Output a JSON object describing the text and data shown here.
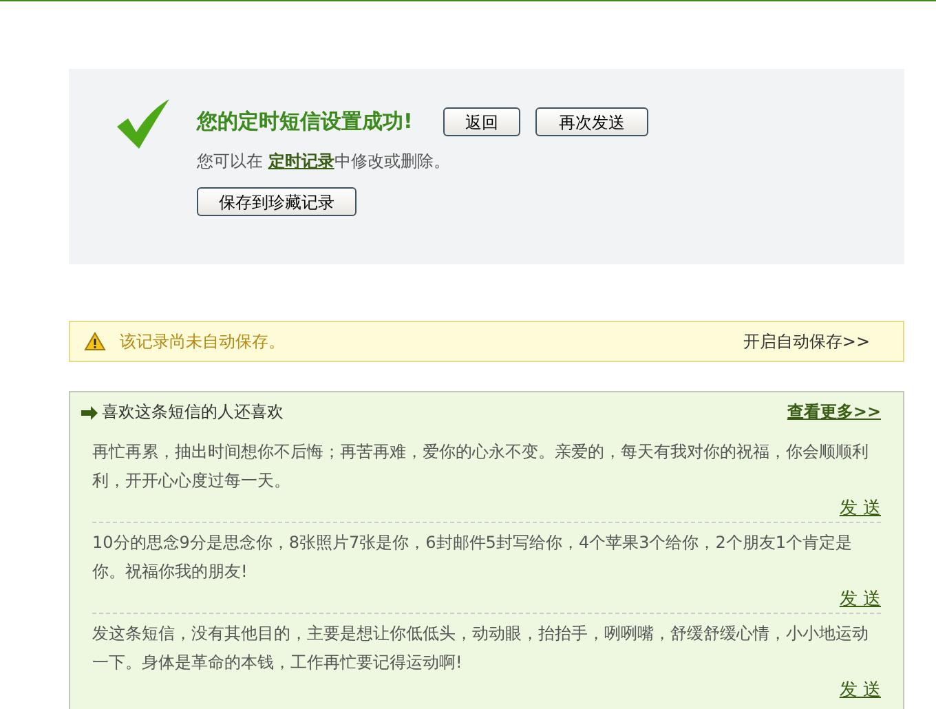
{
  "success": {
    "title": "您的定时短信设置成功!",
    "buttons": [
      "返回",
      "再次发送"
    ],
    "note_before": "您可以在 ",
    "note_link": "定时记录",
    "note_after": "中修改或删除。",
    "save_button": "保存到珍藏记录"
  },
  "warning": {
    "message": "该记录尚未自动保存。",
    "action": "开启自动保存>>"
  },
  "recommend": {
    "title": "喜欢这条短信的人还喜欢",
    "more": "查看更多>>",
    "items": [
      {
        "text": "再忙再累，抽出时间想你不后悔；再苦再难，爱你的心永不变。亲爱的，每天有我对你的祝福，你会顺顺利利，开开心心度过每一天。",
        "action": "发 送"
      },
      {
        "text": "10分的思念9分是思念你，8张照片7张是你，6封邮件5封写给你，4个苹果3个给你，2个朋友1个肯定是你。祝福你我的朋友!",
        "action": "发 送"
      },
      {
        "text": "发这条短信，没有其他目的，主要是想让你低低头，动动眼，抬抬手，咧咧嘴，舒缓舒缓心情，小小地运动一下。身体是革命的本钱，工作再忙要记得运动啊!",
        "action": "发 送"
      }
    ]
  }
}
